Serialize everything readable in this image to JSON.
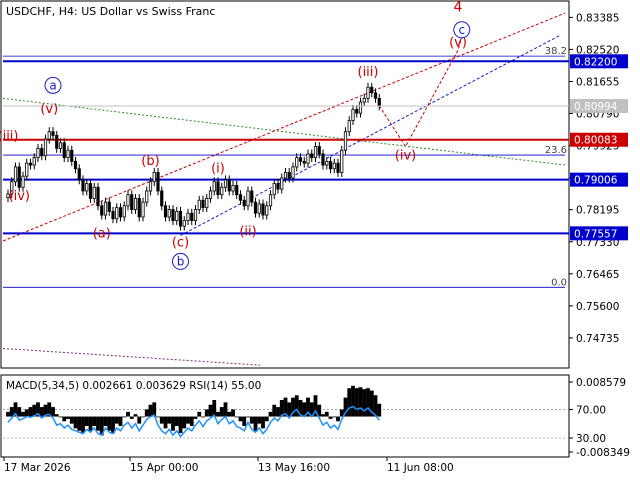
{
  "header": {
    "title": "USDCHF, H4:  US Dollar vs Swiss Franc",
    "indicators": "MACD(5,34,5) 0.002661 0.003629 RSI(14) 55.00"
  },
  "colors": {
    "price": "#000000",
    "level_blue": "#0000cc",
    "level_red": "#cc0000",
    "wave_red": "#cc0000",
    "wave_blue": "#1a1acc",
    "green_trend": "#2e8b2e",
    "purple_trend": "#7a2a7a",
    "rsi": "#1e90ff",
    "axis_text": "#000000"
  },
  "chart_data": [
    {
      "type": "line",
      "name": "price-panel",
      "ylim": [
        0.7395,
        0.838
      ],
      "y_ticks": [
        "0.83385",
        "0.82520",
        "0.81655",
        "0.80790",
        "0.79925",
        "0.79060",
        "0.78195",
        "0.77330",
        "0.76465",
        "0.75600",
        "0.74735"
      ],
      "x_ticks": [
        "17 Mar 2026",
        "15 Apr 00:00",
        "13 May 16:00",
        "11 Jun 08:00"
      ],
      "price_labels": [
        {
          "text": "0.82200",
          "value": 0.822,
          "kind": "blue"
        },
        {
          "text": "0.80994",
          "value": 0.80994,
          "kind": "current"
        },
        {
          "text": "0.80083",
          "value": 0.80083,
          "kind": "red"
        },
        {
          "text": "0.79006",
          "value": 0.79006,
          "kind": "blue"
        },
        {
          "text": "0.77557",
          "value": 0.77557,
          "kind": "blue"
        }
      ],
      "levels": [
        {
          "value": 0.822,
          "kind": "blue"
        },
        {
          "value": 0.80083,
          "kind": "red"
        },
        {
          "value": 0.79006,
          "kind": "blue"
        },
        {
          "value": 0.77557,
          "kind": "blue"
        }
      ],
      "fib_levels": [
        {
          "text": "38.2",
          "value": 0.8234
        },
        {
          "text": "23.6",
          "value": 0.7967
        },
        {
          "text": "0.0",
          "value": 0.761
        }
      ],
      "close_series": [
        0.7862,
        0.7895,
        0.7935,
        0.788,
        0.791,
        0.7945,
        0.794,
        0.796,
        0.7985,
        0.7965,
        0.801,
        0.803,
        0.802,
        0.7985,
        0.8,
        0.796,
        0.798,
        0.795,
        0.793,
        0.79,
        0.787,
        0.789,
        0.785,
        0.788,
        0.783,
        0.7805,
        0.784,
        0.7815,
        0.7795,
        0.7825,
        0.78,
        0.783,
        0.786,
        0.782,
        0.785,
        0.78,
        0.784,
        0.787,
        0.7895,
        0.792,
        0.787,
        0.783,
        0.78,
        0.782,
        0.779,
        0.7815,
        0.7775,
        0.779,
        0.781,
        0.779,
        0.782,
        0.7845,
        0.7825,
        0.785,
        0.787,
        0.7895,
        0.786,
        0.788,
        0.79,
        0.787,
        0.7885,
        0.786,
        0.7845,
        0.783,
        0.787,
        0.784,
        0.781,
        0.7835,
        0.7805,
        0.783,
        0.786,
        0.789,
        0.7875,
        0.7905,
        0.792,
        0.7905,
        0.7935,
        0.796,
        0.795,
        0.7945,
        0.797,
        0.796,
        0.799,
        0.797,
        0.794,
        0.795,
        0.793,
        0.7945,
        0.792,
        0.798,
        0.803,
        0.806,
        0.809,
        0.808,
        0.811,
        0.812,
        0.815,
        0.8135,
        0.812,
        0.81
      ],
      "red_wave_labels": [
        {
          "text": "(iii)",
          "index": 0,
          "value": 0.8008
        },
        {
          "text": "(iv)",
          "index": 3,
          "value": 0.7845
        },
        {
          "text": "(v)",
          "index": 11,
          "value": 0.808
        },
        {
          "text": "(a)",
          "index": 25,
          "value": 0.7745
        },
        {
          "text": "(b)",
          "index": 38,
          "value": 0.794
        },
        {
          "text": "(c)",
          "index": 46,
          "value": 0.772
        },
        {
          "text": "(i)",
          "index": 56,
          "value": 0.792
        },
        {
          "text": "(ii)",
          "index": 64,
          "value": 0.775
        },
        {
          "text": "(iii)",
          "index": 96,
          "value": 0.818
        },
        {
          "text": "(iv)",
          "index": 106,
          "value": 0.7955
        },
        {
          "text": "(v)",
          "index": 120,
          "value": 0.826
        },
        {
          "text": "4",
          "index": 120,
          "value": 0.8355
        }
      ],
      "circled_wave_labels": [
        {
          "text": "a",
          "index": 12,
          "value": 0.8155
        },
        {
          "text": "b",
          "index": 46,
          "value": 0.768
        },
        {
          "text": "c",
          "index": 121,
          "value": 0.8305
        }
      ]
    },
    {
      "type": "bar",
      "name": "macd-rsi-panel",
      "ylim": [
        -0.008349,
        0.008579
      ],
      "y_ticks": [
        "0.008579",
        "70.00",
        "30.00",
        "-0.008349"
      ],
      "macd_values": [
        0.001,
        0.002,
        0.003,
        0.002,
        0.001,
        0.0015,
        0.002,
        0.0025,
        0.003,
        0.002,
        0.0025,
        0.003,
        0.002,
        0.0005,
        0.0,
        -0.001,
        -0.0005,
        -0.0015,
        -0.0025,
        -0.003,
        -0.0035,
        -0.002,
        -0.003,
        -0.002,
        -0.003,
        -0.004,
        -0.002,
        -0.003,
        -0.0035,
        -0.0015,
        -0.002,
        0.0,
        0.001,
        -0.0005,
        0.0005,
        -0.0015,
        0.0,
        0.0015,
        0.0025,
        0.003,
        0.0,
        -0.0015,
        -0.0025,
        -0.0015,
        -0.003,
        -0.002,
        -0.0035,
        -0.0025,
        -0.0015,
        -0.002,
        -0.0005,
        0.001,
        0.0,
        0.0015,
        0.0025,
        0.0035,
        0.001,
        0.002,
        0.003,
        0.001,
        0.0015,
        0.0,
        -0.001,
        -0.002,
        0.0,
        -0.0015,
        -0.003,
        -0.0015,
        -0.0025,
        -0.001,
        0.001,
        0.0025,
        0.002,
        0.0035,
        0.004,
        0.003,
        0.004,
        0.0045,
        0.0035,
        0.003,
        0.004,
        0.003,
        0.0045,
        0.0025,
        0.0005,
        0.001,
        -0.0005,
        0.0,
        -0.001,
        0.0015,
        0.004,
        0.006,
        0.0065,
        0.006,
        0.0062,
        0.0058,
        0.006,
        0.0055,
        0.0045,
        0.0027
      ],
      "rsi_values": [
        52,
        58,
        64,
        55,
        57,
        60,
        59,
        61,
        64,
        58,
        62,
        63,
        58,
        48,
        50,
        44,
        48,
        42,
        40,
        38,
        36,
        42,
        38,
        44,
        36,
        34,
        44,
        38,
        36,
        44,
        40,
        48,
        52,
        44,
        50,
        40,
        48,
        56,
        60,
        62,
        48,
        40,
        36,
        42,
        34,
        40,
        32,
        38,
        44,
        40,
        48,
        54,
        46,
        54,
        58,
        62,
        50,
        56,
        60,
        50,
        54,
        46,
        44,
        40,
        52,
        42,
        38,
        44,
        36,
        42,
        52,
        58,
        54,
        62,
        64,
        58,
        66,
        70,
        62,
        60,
        66,
        60,
        68,
        58,
        48,
        52,
        44,
        48,
        42,
        56,
        66,
        72,
        74,
        70,
        72,
        68,
        72,
        66,
        62,
        55
      ]
    }
  ]
}
